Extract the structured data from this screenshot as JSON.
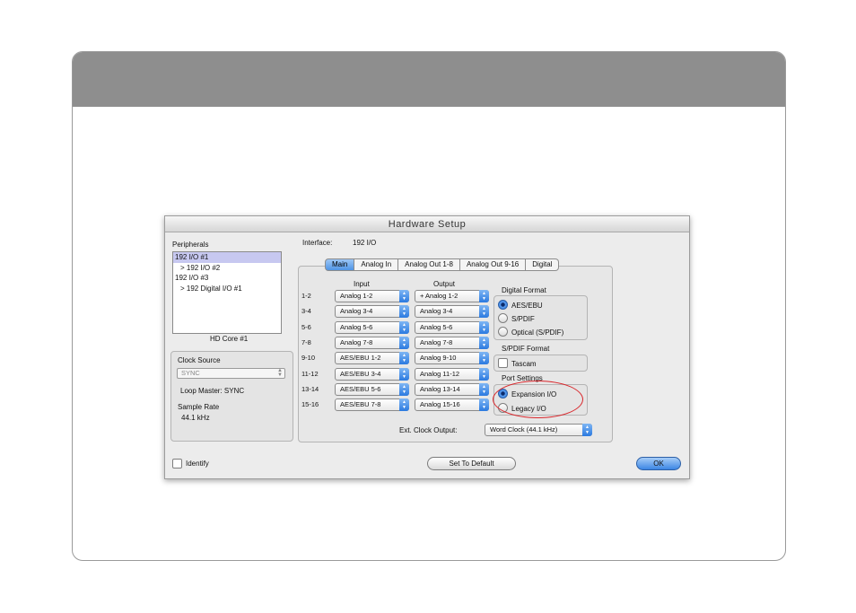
{
  "window": {
    "title": "Hardware Setup"
  },
  "peripherals": {
    "label": "Peripherals",
    "items": [
      {
        "label": "192 I/O #1",
        "selected": true,
        "indent": false
      },
      {
        "label": "> 192 I/O #2",
        "selected": false,
        "indent": true
      },
      {
        "label": "192 I/O #3",
        "selected": false,
        "indent": false
      },
      {
        "label": "> 192 Digital I/O #1",
        "selected": false,
        "indent": true
      }
    ],
    "core_label": "HD Core #1"
  },
  "clock": {
    "source_label": "Clock Source",
    "source_value": "SYNC",
    "loop_master": "Loop Master: SYNC",
    "sample_rate_label": "Sample Rate",
    "sample_rate_value": "44.1 kHz"
  },
  "interface": {
    "label": "Interface:",
    "value": "192 I/O"
  },
  "tabs": [
    "Main",
    "Analog In",
    "Analog Out 1-8",
    "Analog Out 9-16",
    "Digital"
  ],
  "active_tab": "Main",
  "columns": {
    "input": "Input",
    "output": "Output"
  },
  "channels": [
    {
      "pair": "1-2",
      "input": "Analog 1-2",
      "output": "+ Analog 1-2"
    },
    {
      "pair": "3-4",
      "input": "Analog 3-4",
      "output": "Analog 3-4"
    },
    {
      "pair": "5-6",
      "input": "Analog 5-6",
      "output": "Analog 5-6"
    },
    {
      "pair": "7-8",
      "input": "Analog 7-8",
      "output": "Analog 7-8"
    },
    {
      "pair": "9-10",
      "input": "AES/EBU 1-2",
      "output": "Analog 9-10"
    },
    {
      "pair": "11-12",
      "input": "AES/EBU 3-4",
      "output": "Analog 11-12"
    },
    {
      "pair": "13-14",
      "input": "AES/EBU 5-6",
      "output": "Analog 13-14"
    },
    {
      "pair": "15-16",
      "input": "AES/EBU 7-8",
      "output": "Analog 15-16"
    }
  ],
  "digital_format": {
    "label": "Digital Format",
    "options": [
      "AES/EBU",
      "S/PDIF",
      "Optical (S/PDIF)"
    ],
    "selected": 0
  },
  "spdif_format": {
    "label": "S/PDIF Format",
    "tascam": "Tascam"
  },
  "port_settings": {
    "label": "Port Settings",
    "options": [
      "Expansion I/O",
      "Legacy I/O"
    ],
    "selected": 0
  },
  "ext_clock": {
    "label": "Ext. Clock Output:",
    "value": "Word Clock (44.1 kHz)"
  },
  "footer": {
    "identify": "Identify",
    "set_default": "Set To Default",
    "ok": "OK"
  },
  "colors": {
    "header_band": "#8e8e8e",
    "highlight_ring": "#d9252a",
    "aqua_blue": "#3c86e4"
  }
}
